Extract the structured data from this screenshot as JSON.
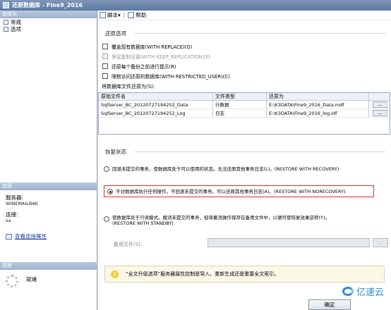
{
  "window": {
    "title": "还原数据库 - Fine9_2016"
  },
  "left": {
    "select_page_header": "选择页",
    "pages": [
      {
        "label": "常规"
      },
      {
        "label": "选项"
      }
    ],
    "connection_header": "连接",
    "server_label": "服务器:",
    "server_value": "WINEMAILBAK",
    "connection_label": "连接:",
    "connection_value": "sa",
    "view_connection_link": "查看连接属性",
    "progress_header": "进度",
    "progress_status": "就绪"
  },
  "toolbar": {
    "script_label": "脚本",
    "help_label": "帮助"
  },
  "options": {
    "group_title": "还原选项",
    "checkboxes": [
      {
        "label": "覆盖现有数据库(WITH REPLACE)(O)",
        "checked": false,
        "disabled": false
      },
      {
        "label": "保留复制设置(WITH KEEP_REPLICATION)(P)",
        "checked": false,
        "disabled": true
      },
      {
        "label": "还原每个备份之前进行提示(R)",
        "checked": false,
        "disabled": false
      },
      {
        "label": "限制访问还原的数据库(WITH RESTRICTED_USER)(C)",
        "checked": false,
        "disabled": false
      }
    ],
    "files_label": "将数据库文件还原为(S):",
    "columns": [
      "原始文件名",
      "文件类型",
      "还原为",
      ""
    ],
    "files": [
      {
        "original": "SqlServer_BC_20120727194252_Data",
        "type": "行数据",
        "restore_as": "E:\\K3DATA\\Fine9_2016_Data.mdf",
        "btn": "..."
      },
      {
        "original": "SqlServer_BC_20120727194252_Log",
        "type": "日志",
        "restore_as": "E:\\K3DATA\\Fine9_2016_log.ldf",
        "btn": "..."
      }
    ]
  },
  "recovery": {
    "group_title": "恢复状态",
    "options": [
      {
        "label": "回滚未提交的事务，使数据库处于可以使用的状态。无法还原其他事务日志(L)。(RESTORE WITH RECOVERY)",
        "selected": false
      },
      {
        "label": "不对数据库执行任何操作，不回滚未提交的事务。可以还原其他事务日志(A)。(RESTORE WITH NORECOVERY)",
        "selected": true
      },
      {
        "label_line1": "使数据库处于只读模式。撤消未提交的事务，但将撤消操作保存在备用文件中，以便可使恢复效果逆转(Y)。",
        "label_line2": "(RESTORE WITH STANDBY)",
        "selected": false
      }
    ],
    "standby_label": "备用文件(S):",
    "standby_value": "",
    "standby_btn": "..."
  },
  "info": {
    "icon": "i",
    "text": "“全文升级选项”服务器属性控制是导入、重新生成还是重置全文索引。"
  },
  "footer": {
    "ok_label": "确定"
  },
  "watermark": {
    "text": "亿速云"
  }
}
